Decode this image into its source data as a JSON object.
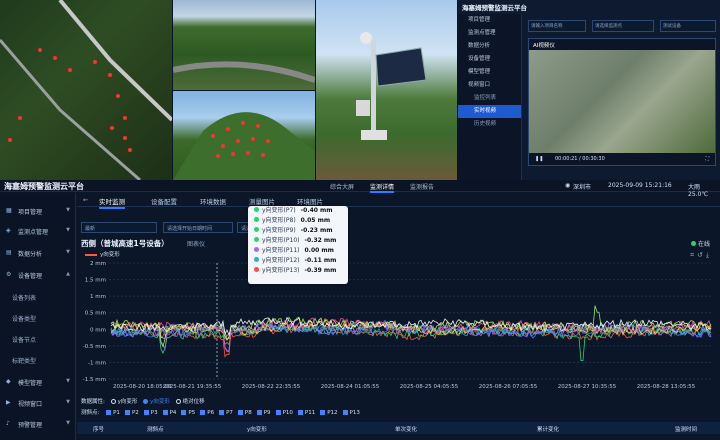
{
  "top_app": {
    "title": "海塞姆预警监测云平台",
    "menu": [
      "项目管理",
      "监测点管理",
      "数据分析",
      "设备管理",
      "模型管理",
      "视频窗口",
      "监控列表",
      "实时视频",
      "历史视频"
    ],
    "filters": [
      "请输入项目名称",
      "请选择监测点",
      "测试设备"
    ],
    "video_title": "AI视频仪",
    "time": "00:00:21 / 00:30:30"
  },
  "header": {
    "title": "海塞姆预警监测云平台",
    "nav": [
      "综合大屏",
      "监测详情",
      "监测报告"
    ],
    "location": "深圳市",
    "datetime": "2025-09-09 15:21:16",
    "weather": "大雨 25.0℃"
  },
  "sidebar": [
    {
      "label": "项目管理",
      "icon": "grid-icon"
    },
    {
      "label": "监测点管理",
      "icon": "pin-icon"
    },
    {
      "label": "数据分析",
      "icon": "chart-icon"
    },
    {
      "label": "设备管理",
      "icon": "gear-icon"
    },
    {
      "label": "设备列表"
    },
    {
      "label": "设备类型"
    },
    {
      "label": "设备节点"
    },
    {
      "label": "标靶类型"
    },
    {
      "label": "模型管理",
      "icon": "cube-icon"
    },
    {
      "label": "视频窗口",
      "icon": "video-icon"
    },
    {
      "label": "预警管理",
      "icon": "bell-icon"
    }
  ],
  "tabs": [
    "实时监测",
    "设备配置",
    "环境数据",
    "测量图片",
    "环境图片"
  ],
  "filters": {
    "select1": "最新",
    "select2": "请选择开始日期时间",
    "select3": "请选择结束"
  },
  "chart_title": "西侧（普城高速1号设备）",
  "chart_subtitle": "图表仪",
  "legend_label": "y向变形",
  "online_label": "在线",
  "tooltip": [
    {
      "label": "y向变形(P7)",
      "value": "-0.40 mm",
      "color": "#2bd36b"
    },
    {
      "label": "y向变形(P8)",
      "value": "0.05 mm",
      "color": "#2bd36b"
    },
    {
      "label": "y向变形(P9)",
      "value": "-0.23 mm",
      "color": "#2bd36b"
    },
    {
      "label": "y向变形(P10)",
      "value": "-0.32 mm",
      "color": "#2bd36b"
    },
    {
      "label": "y向变形(P11)",
      "value": "0.00 mm",
      "color": "#a26bff"
    },
    {
      "label": "y向变形(P12)",
      "value": "-0.11 mm",
      "color": "#2bb0c8"
    },
    {
      "label": "y向变形(P13)",
      "value": "-0.39 mm",
      "color": "#ff4a4a"
    }
  ],
  "data_attr": {
    "label": "数据属性:",
    "options": [
      "y向变形",
      "y向变形",
      "绝对位移"
    ],
    "selected": 1
  },
  "points": {
    "label": "测斜点:",
    "items": [
      "P1",
      "P2",
      "P3",
      "P4",
      "P5",
      "P6",
      "P7",
      "P8",
      "P9",
      "P10",
      "P11",
      "P12",
      "P13"
    ]
  },
  "table_headers": [
    "序号",
    "测斜点",
    "y向变形",
    "单次变化",
    "累计变化",
    "监测时间"
  ],
  "chart_data": {
    "type": "line",
    "ylabel": "mm",
    "ylim": [
      -1.5,
      2
    ],
    "yticks": [
      "2 mm",
      "1.5 mm",
      "1 mm",
      "0.5 mm",
      "0 mm",
      "-0.5 mm",
      "-1 mm",
      "-1.5 mm"
    ],
    "xticks": [
      "2025-08-20 18:05:00",
      "2025-08-21 19:35:55",
      "2025-08-22 22:35:55",
      "2025-08-24 01:05:55",
      "2025-08-25 04:05:55",
      "2025-08-26 07:05:55",
      "2025-08-27 10:35:55",
      "2025-08-28 13:05:55"
    ],
    "series_colors": [
      "#ff5a3c",
      "#2bd36b",
      "#3d86ff",
      "#a26bff",
      "#2bb0c8",
      "#ffd23c",
      "#ff4aa8",
      "#9ae05b",
      "#f0f0f0"
    ]
  },
  "colors": {
    "accent": "#2f7cff",
    "bg": "#0b1628"
  }
}
